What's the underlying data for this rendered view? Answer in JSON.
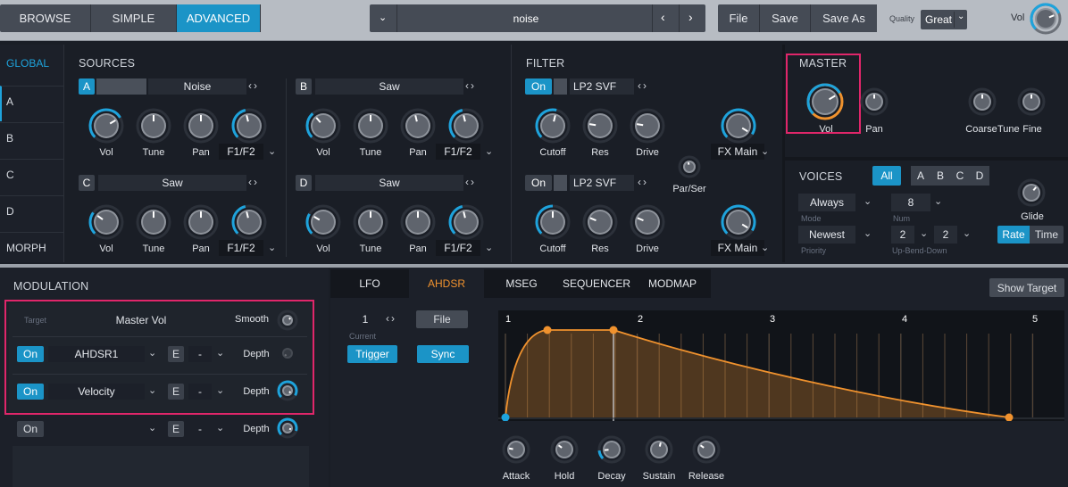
{
  "top": {
    "modes": [
      "BROWSE",
      "SIMPLE",
      "ADVANCED"
    ],
    "active_mode": "ADVANCED",
    "preset_name": "noise",
    "file": "File",
    "save": "Save",
    "save_as": "Save As",
    "quality_label": "Quality",
    "quality_value": "Great",
    "vol_label": "Vol"
  },
  "side": {
    "items": [
      "GLOBAL",
      "A",
      "B",
      "C",
      "D",
      "MORPH"
    ]
  },
  "sources": {
    "title": "SOURCES",
    "oscs": [
      {
        "letter": "A",
        "name": "Noise",
        "labels": [
          "Vol",
          "Tune",
          "Pan"
        ],
        "mode": "F1/F2"
      },
      {
        "letter": "B",
        "name": "Saw",
        "labels": [
          "Vol",
          "Tune",
          "Pan"
        ],
        "mode": "F1/F2"
      },
      {
        "letter": "C",
        "name": "Saw",
        "labels": [
          "Vol",
          "Tune",
          "Pan"
        ],
        "mode": "F1/F2"
      },
      {
        "letter": "D",
        "name": "Saw",
        "labels": [
          "Vol",
          "Tune",
          "Pan"
        ],
        "mode": "F1/F2"
      }
    ]
  },
  "filter": {
    "title": "FILTER",
    "filters": [
      {
        "on": "On",
        "type": "LP2 SVF",
        "labels": [
          "Cutoff",
          "Res",
          "Drive"
        ],
        "route": "FX Main"
      },
      {
        "on": "On",
        "type": "LP2 SVF",
        "labels": [
          "Cutoff",
          "Res",
          "Drive"
        ],
        "route": "FX Main"
      }
    ],
    "parser": "Par/Ser"
  },
  "master": {
    "title": "MASTER",
    "vol": "Vol",
    "pan": "Pan",
    "coarse": "Coarse",
    "tune": "Tune",
    "fine": "Fine"
  },
  "voices": {
    "title": "VOICES",
    "tabs": [
      "All",
      "A",
      "B",
      "C",
      "D"
    ],
    "mode_value": "Always",
    "mode_label": "Mode",
    "num_value": "8",
    "num_label": "Num",
    "priority_value": "Newest",
    "priority_label": "Priority",
    "bend_up": "2",
    "bend_down": "2",
    "bend_label": "Up-Bend-Down",
    "glide": "Glide",
    "rate": "Rate",
    "time": "Time"
  },
  "modulation": {
    "title": "MODULATION",
    "target_label": "Target",
    "target_value": "Master Vol",
    "smooth": "Smooth",
    "rows": [
      {
        "on": "On",
        "source": "AHDSR1",
        "e": "E",
        "dash": "-",
        "depth": "Depth"
      },
      {
        "on": "On",
        "source": "Velocity",
        "e": "E",
        "dash": "-",
        "depth": "Depth"
      },
      {
        "on": "On",
        "source": "",
        "e": "E",
        "dash": "-",
        "depth": "Depth"
      }
    ]
  },
  "env": {
    "tabs": [
      "LFO",
      "AHDSR",
      "MSEG",
      "SEQUENCER",
      "MODMAP"
    ],
    "active_tab": "AHDSR",
    "show_target": "Show Target",
    "current_value": "1",
    "current_label": "Current",
    "file": "File",
    "trigger": "Trigger",
    "sync": "Sync",
    "beats": [
      "1",
      "2",
      "3",
      "4",
      "5"
    ],
    "knobs": [
      "Attack",
      "Hold",
      "Decay",
      "Sustain",
      "Release"
    ]
  },
  "colors": {
    "accent": "#1b94c7",
    "orange": "#f0922e",
    "highlight": "#e0266a"
  }
}
